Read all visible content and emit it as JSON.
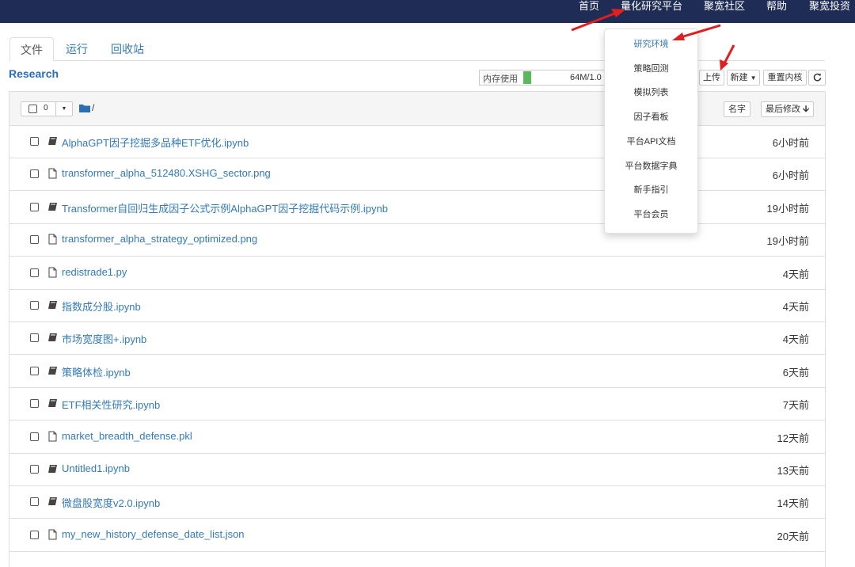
{
  "topnav": {
    "items": [
      "首页",
      "量化研究平台",
      "聚宽社区",
      "帮助",
      "聚宽投资"
    ]
  },
  "tabs": [
    "文件",
    "运行",
    "回收站"
  ],
  "breadcrumb": "Research",
  "memory": {
    "label": "内存使用",
    "value": "64M/1.0",
    "fill_fraction": 0.06,
    "color": "#5cb85c"
  },
  "toolbar": {
    "upload": "上传",
    "new": "新建",
    "restart": "重置内核",
    "refresh_icon": "refresh-icon"
  },
  "list_header": {
    "selected_count": "0",
    "path": "/",
    "sort_name": "名字",
    "sort_modified": "最后修改"
  },
  "files": [
    {
      "name": "AlphaGPT因子挖掘多品种ETF优化.ipynb",
      "time": "6小时前",
      "type": "notebook"
    },
    {
      "name": "transformer_alpha_512480.XSHG_sector.png",
      "time": "6小时前",
      "type": "file"
    },
    {
      "name": "Transformer自回归生成因子公式示例AlphaGPT因子挖掘代码示例.ipynb",
      "time": "19小时前",
      "type": "notebook"
    },
    {
      "name": "transformer_alpha_strategy_optimized.png",
      "time": "19小时前",
      "type": "file"
    },
    {
      "name": "redistrade1.py",
      "time": "4天前",
      "type": "file"
    },
    {
      "name": "指数成分股.ipynb",
      "time": "4天前",
      "type": "notebook"
    },
    {
      "name": "市场宽度图+.ipynb",
      "time": "4天前",
      "type": "notebook"
    },
    {
      "name": "策略体检.ipynb",
      "time": "6天前",
      "type": "notebook"
    },
    {
      "name": "ETF相关性研究.ipynb",
      "time": "7天前",
      "type": "notebook"
    },
    {
      "name": "market_breadth_defense.pkl",
      "time": "12天前",
      "type": "file"
    },
    {
      "name": "Untitled1.ipynb",
      "time": "13天前",
      "type": "notebook"
    },
    {
      "name": "微盘股宽度v2.0.ipynb",
      "time": "14天前",
      "type": "notebook"
    },
    {
      "name": "my_new_history_defense_date_list.json",
      "time": "20天前",
      "type": "file"
    }
  ],
  "dropdown": {
    "items": [
      "研究环境",
      "策略回测",
      "模拟列表",
      "因子看板",
      "平台API文档",
      "平台数据字典",
      "新手指引",
      "平台会员"
    ],
    "active_color": "#337ab7"
  },
  "colors": {
    "topbar": "#1f2d56",
    "link": "#337ab7",
    "annotation_arrow": "#e02020"
  }
}
